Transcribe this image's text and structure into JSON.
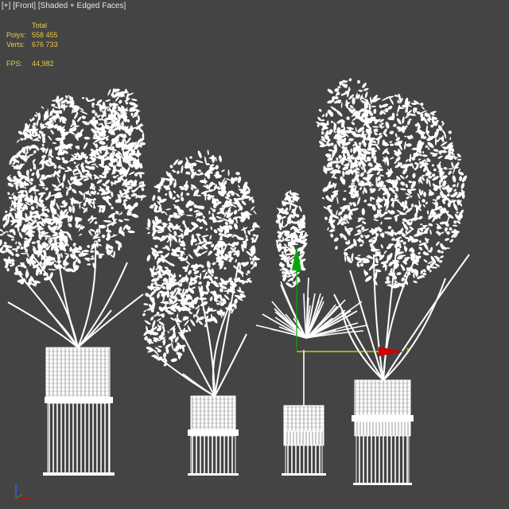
{
  "viewport": {
    "label_plus": "[+]",
    "label_view": "[Front]",
    "label_mode": "[Shaded + Edged Faces]",
    "background": "#444444",
    "wire_color": "#ffffff"
  },
  "stats": {
    "header": "Total",
    "polys_label": "Polys:",
    "polys_value": "558 455",
    "verts_label": "Verts:",
    "verts_value": "676 733",
    "fps_label": "FPS:",
    "fps_value": "44,982",
    "color": "#e8c84a"
  },
  "gizmo": {
    "x_label": "x",
    "x_color": "#cc0000",
    "y_color": "#00aa00",
    "axis_line_color": "#e6e600"
  },
  "axis_tripod": {
    "colors": [
      "#cc0000",
      "#00aa00",
      "#3366ff"
    ]
  }
}
